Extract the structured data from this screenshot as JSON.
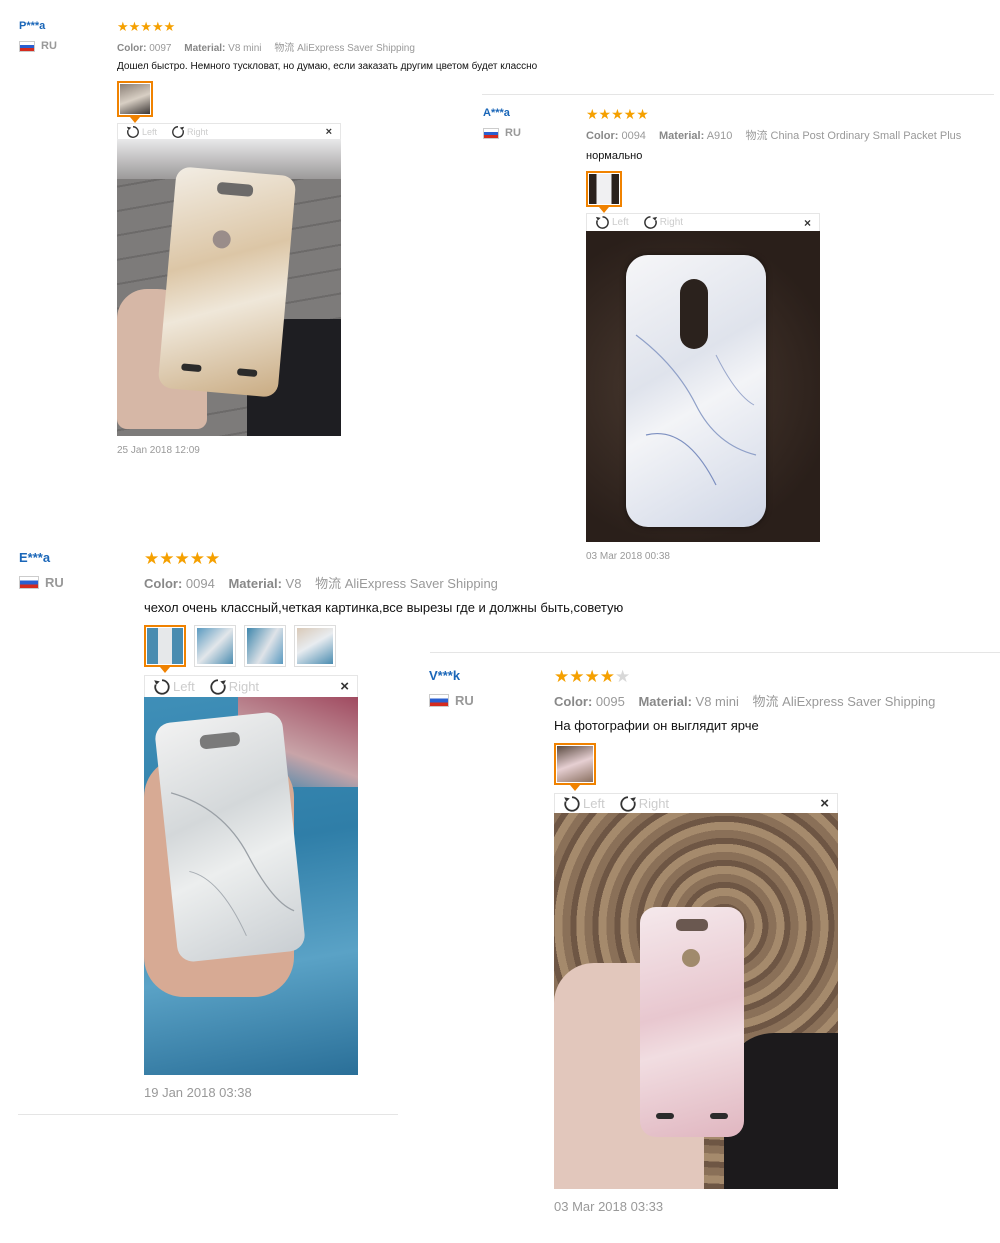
{
  "colors": {
    "accent": "#f08200",
    "username": "#1a66b8",
    "star": "#f5a000",
    "meta": "#999999"
  },
  "labels": {
    "color": "Color:",
    "material": "Material:",
    "logistics_icon": "物流",
    "rotate_left": "Left",
    "rotate_right": "Right",
    "close": "×"
  },
  "reviews": [
    {
      "user": "P***a",
      "country": "RU",
      "stars": "★★★★★",
      "rating": 5,
      "color": "0097",
      "material": "V8 mini",
      "shipping": "AliExpress Saver Shipping",
      "text": "Дошел быстро. Немного тускловат, но думаю, если заказать другим цветом будет классно",
      "date": "25 Jan 2018 12:09",
      "photo_count": 1
    },
    {
      "user": "A***a",
      "country": "RU",
      "stars": "★★★★★",
      "rating": 5,
      "color": "0094",
      "material": "A910",
      "shipping": "China Post Ordinary Small Packet Plus",
      "text": "нормально",
      "date": "03 Mar 2018 00:38",
      "photo_count": 1
    },
    {
      "user": "E***a",
      "country": "RU",
      "stars": "★★★★★",
      "rating": 5,
      "color": "0094",
      "material": "V8",
      "shipping": "AliExpress Saver Shipping",
      "text": "чехол очень классный,четкая картинка,все вырезы где и должны быть,советую",
      "date": "19 Jan 2018 03:38",
      "photo_count": 4
    },
    {
      "user": "V***k",
      "country": "RU",
      "stars": "★★★★",
      "stars_off": "★",
      "rating": 4,
      "color": "0095",
      "material": "V8 mini",
      "shipping": "AliExpress Saver Shipping",
      "text": "На фотографии он выглядит ярче",
      "date": "03 Mar 2018 03:33",
      "photo_count": 1
    }
  ]
}
